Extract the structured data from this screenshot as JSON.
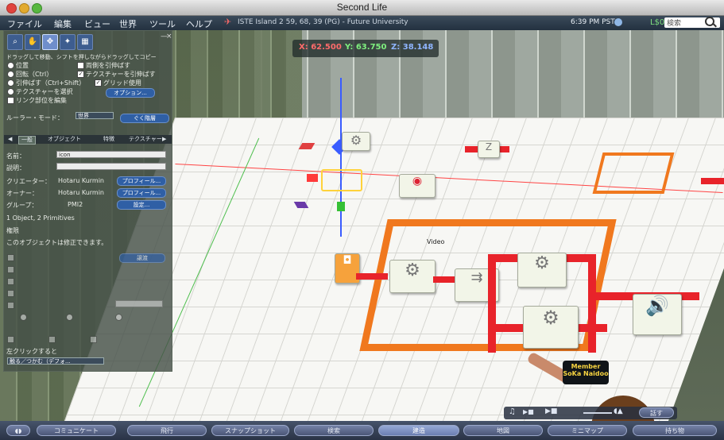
{
  "window": {
    "title": "Second Life"
  },
  "menubar": {
    "items": [
      "ファイル",
      "編集",
      "ビュー",
      "世界",
      "ツール",
      "ヘルプ"
    ],
    "region": "ISTE Island 2 59, 68, 39 (PG) - Future University",
    "clock": "6:39 PM PST",
    "money": "L$0",
    "search_placeholder": "検索"
  },
  "coords": {
    "x": "X: 62.500",
    "y": "Y: 63.750",
    "z": "Z: 38.148"
  },
  "panel": {
    "hint": "ドラッグして移動、シフトを押しながらドラッグしてコピー",
    "radios": [
      "位置",
      "回転（Ctrl）",
      "引伸ばす（Ctrl+Shift）",
      "テクスチャーを選択"
    ],
    "checks": [
      "両側を引伸ばす",
      "テクスチャーを引伸ばす",
      "グリッド使用",
      "リンク部位を編集"
    ],
    "options_button": "オプション...",
    "ruler_label": "ルーラー・モード：",
    "ruler_value": "世界",
    "ruler_button": "ぐく階層",
    "tabs": [
      "一般",
      "オブジェクト",
      "特徴",
      "テクスチャー"
    ],
    "name_label": "名前：",
    "name_value": "icon",
    "desc_label": "説明：",
    "creator_label": "クリエーター：",
    "creator_value": "Hotaru Kurmin",
    "owner_label": "オーナー：",
    "owner_value": "Hotaru Kurmin",
    "profile_button": "プロフィール...",
    "group_label": "グループ：",
    "group_value": "PMI2",
    "group_button": "設定...",
    "primitives": "1 Object, 2 Primitives",
    "permissions": "権限",
    "modify_note": "このオブジェクトは修正できます。",
    "deed_button": "譲渡",
    "click_label": "左クリックすると",
    "click_value": "触る／つかむ（デフォ..."
  },
  "scene": {
    "video_label": "Video",
    "avatar_tag_line1": "Member",
    "avatar_tag_line2": "SoKa Naidoo"
  },
  "bottom": {
    "buttons": [
      "コミュニケート",
      "飛行",
      "スナップショット",
      "検索",
      "建造",
      "地図",
      "ミニマップ",
      "持ち物"
    ],
    "active": "建造",
    "speak": "話す"
  }
}
